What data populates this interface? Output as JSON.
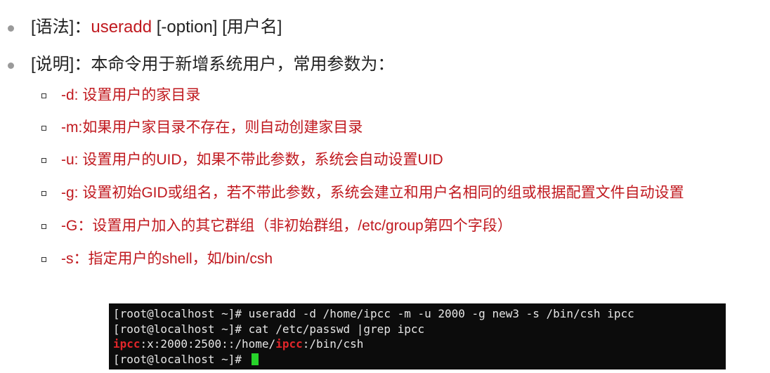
{
  "syntax": {
    "label": "[语法]：",
    "command": "useradd",
    "rest": " [-option]   [用户名]"
  },
  "description": {
    "text": "[说明]：本命令用于新增系统用户，常用参数为："
  },
  "options": [
    "-d: 设置用户的家目录",
    "-m:如果用户家目录不存在，则自动创建家目录",
    "-u: 设置用户的UID，如果不带此参数，系统会自动设置UID",
    "-g: 设置初始GID或组名，若不带此参数，系统会建立和用户名相同的组或根据配置文件自动设置",
    "-G：设置用户加入的其它群组（非初始群组，/etc/group第四个字段）",
    "-s：指定用户的shell，如/bin/csh"
  ],
  "terminal": {
    "line1": "[root@localhost ~]# useradd -d /home/ipcc -m -u 2000 -g new3 -s /bin/csh ipcc",
    "line2": "[root@localhost ~]# cat /etc/passwd |grep ipcc",
    "line3": {
      "seg1": "ipcc",
      "seg2": ":x:2000:2500::/home/",
      "seg3": "ipcc",
      "seg4": ":/bin/csh"
    },
    "line4": "[root@localhost ~]# "
  },
  "colors": {
    "accent_red": "#c0191f",
    "terminal_bg": "#0c0c0c",
    "cursor_green": "#27d32a"
  }
}
